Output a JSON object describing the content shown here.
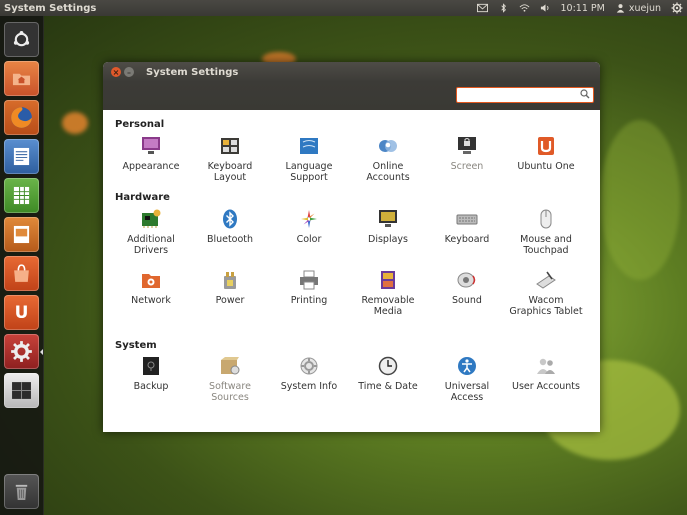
{
  "topbar": {
    "app_title": "System Settings",
    "time": "10:11 PM",
    "user": "xuejun",
    "tray_icons": [
      "mail-icon",
      "bluetooth-icon",
      "wifi-icon",
      "volume-icon",
      "user-icon",
      "gear-icon"
    ]
  },
  "launcher": {
    "items": [
      "ubuntu-dash",
      "home-folder",
      "firefox",
      "libreoffice-writer",
      "libreoffice-calc",
      "libreoffice-impress",
      "software-center",
      "ubuntu-one",
      "system-settings",
      "workspace-switcher",
      "trash"
    ]
  },
  "window": {
    "title": "System Settings",
    "search": {
      "placeholder": "",
      "value": ""
    },
    "sections": {
      "personal": "Personal",
      "hardware": "Hardware",
      "system": "System"
    },
    "personal_items": [
      "Appearance",
      "Keyboard Layout",
      "Language Support",
      "Online Accounts",
      "Screen",
      "Ubuntu One"
    ],
    "hardware_items": [
      "Additional Drivers",
      "Bluetooth",
      "Color",
      "Displays",
      "Keyboard",
      "Mouse and Touchpad",
      "Network",
      "Power",
      "Printing",
      "Removable Media",
      "Sound",
      "Wacom Graphics Tablet"
    ],
    "system_items": [
      "Backup",
      "Software Sources",
      "System Info",
      "Time & Date",
      "Universal Access",
      "User Accounts"
    ]
  },
  "colors": {
    "accent": "#e2581f",
    "panel": "#3c3b37"
  }
}
